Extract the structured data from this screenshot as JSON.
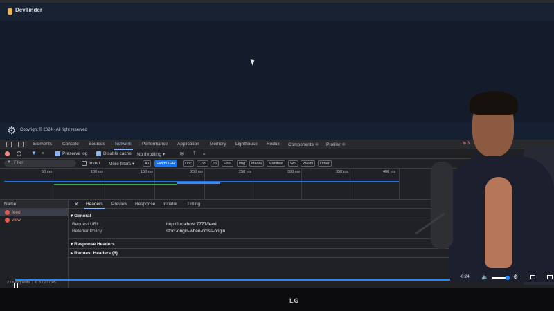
{
  "app": {
    "title": "DevTinder",
    "footer_text": "Copyright © 2024 - All right reserved"
  },
  "devtools": {
    "tabs": [
      "Elements",
      "Console",
      "Sources",
      "Network",
      "Performance",
      "Application",
      "Memory",
      "Lighthouse",
      "Redux",
      "Components ⚛",
      "Profiler ⚛"
    ],
    "active_tab": "Network",
    "error_count": "3",
    "toolbar": {
      "preserve_log": "Preserve log",
      "preserve_log_checked": true,
      "disable_cache": "Disable cache",
      "disable_cache_checked": true,
      "throttling": "No throttling"
    },
    "filter": {
      "placeholder": "Filter",
      "invert": "Invert",
      "more_filters": "More filters ▾",
      "types": [
        "All",
        "Fetch/XHR",
        "Doc",
        "CSS",
        "JS",
        "Font",
        "Img",
        "Media",
        "Manifest",
        "WS",
        "Wasm",
        "Other"
      ],
      "active_type": "Fetch/XHR"
    },
    "timeline": {
      "ticks": [
        "50 ms",
        "100 ms",
        "150 ms",
        "200 ms",
        "250 ms",
        "300 ms",
        "350 ms",
        "400 ms"
      ]
    },
    "requests": {
      "header": "Name",
      "items": [
        {
          "name": "feed",
          "status": "error",
          "selected": true
        },
        {
          "name": "view",
          "status": "error",
          "selected": false
        }
      ],
      "status": "2 / 6 requests",
      "transferred": "0 B / 277 kB"
    },
    "details": {
      "tabs": [
        "Headers",
        "Preview",
        "Response",
        "Initiator",
        "Timing"
      ],
      "active_tab": "Headers",
      "general_title": "▾ General",
      "request_url_label": "Request URL:",
      "request_url": "http://localhost:7777/feed",
      "referrer_label": "Referrer Policy:",
      "referrer": "strict-origin-when-cross-origin",
      "response_headers": "▾ Response Headers",
      "request_headers": "▸ Request Headers (6)"
    }
  },
  "video": {
    "time_remaining": "-0:24",
    "progress": 1.0
  },
  "monitor": {
    "brand": "LG"
  },
  "icons": [
    "gear-icon",
    "record-icon",
    "clear-icon",
    "filter-icon",
    "search-icon",
    "wifi-icon",
    "upload-icon",
    "download-icon",
    "close-icon",
    "error-icon",
    "play-pause-icon",
    "volume-icon",
    "settings-icon",
    "theater-icon",
    "pip-icon"
  ],
  "colors": {
    "accent": "#8ab4f8",
    "error": "#f28b82",
    "chip_active": "#1a73e8",
    "page_bg": "#141c2c"
  }
}
